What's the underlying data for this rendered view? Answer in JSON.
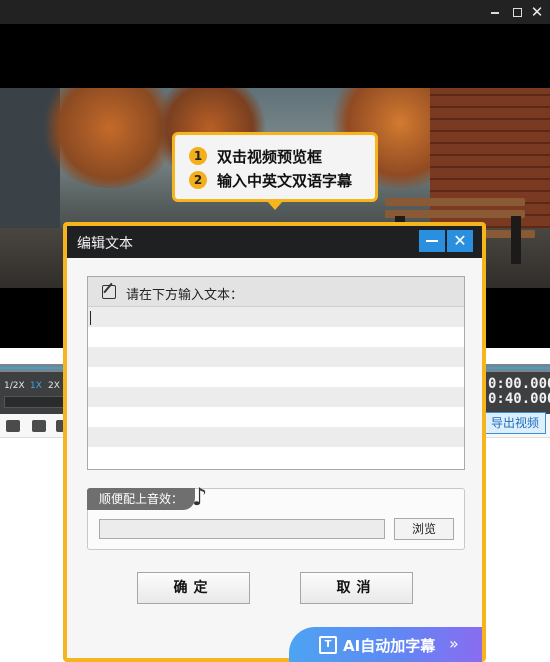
{
  "window": {
    "close_glyph": "✕"
  },
  "tooltip": {
    "steps": [
      {
        "num": "1",
        "text": "双击视频预览框"
      },
      {
        "num": "2",
        "text": "输入中英文双语字幕"
      }
    ]
  },
  "player": {
    "speeds": [
      "1/2X",
      "1X",
      "2X"
    ],
    "active_speed": "1X",
    "time_current": "0:00.000",
    "time_total": "0:40.000",
    "export_label": "导出视频"
  },
  "dialog": {
    "title": "编辑文本",
    "close_glyph": "✕",
    "text_prompt": "请在下方输入文本：",
    "sfx_label": "顺便配上音效：",
    "sfx_value": "",
    "browse_label": "浏览",
    "ok_label": "确定",
    "cancel_label": "取消",
    "ai_label": "AI自动加字幕",
    "ai_icon_text": "T",
    "ai_chevron": "»"
  },
  "colors": {
    "accent_orange": "#f7b51d",
    "accent_blue": "#2b8fe0",
    "ai_gradient_start": "#4da4f2",
    "ai_gradient_end": "#8a6cf0"
  }
}
